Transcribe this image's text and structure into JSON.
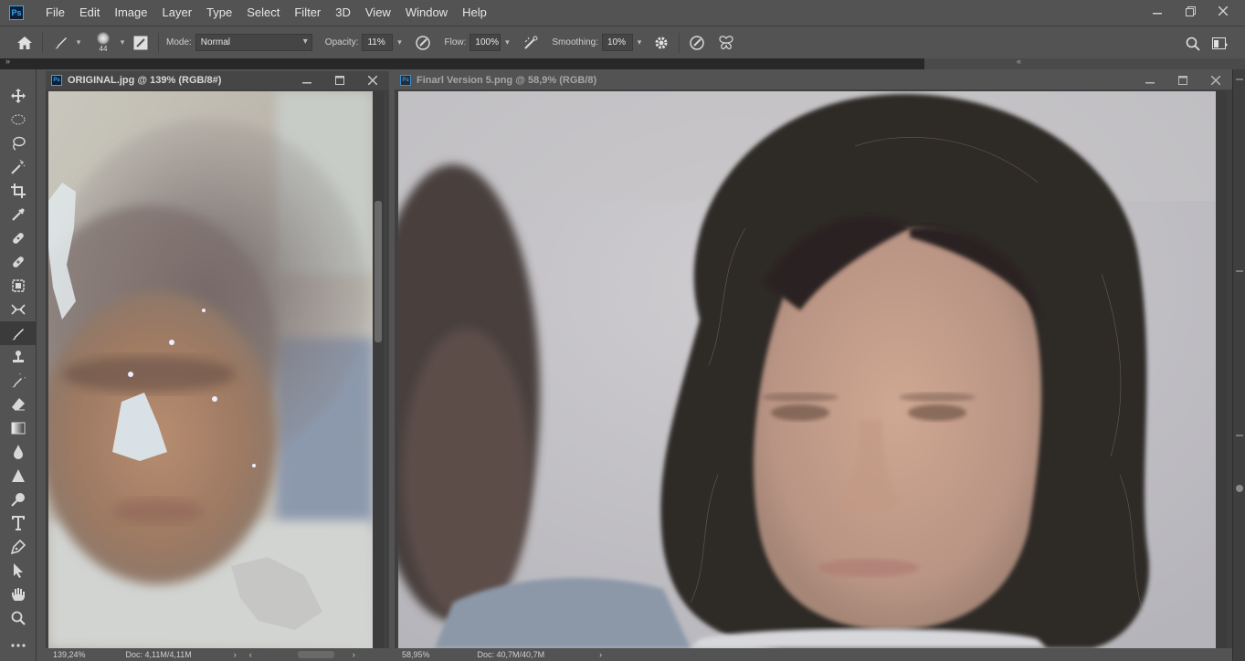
{
  "app": {
    "logo": "Ps",
    "menu": [
      "File",
      "Edit",
      "Image",
      "Layer",
      "Type",
      "Select",
      "Filter",
      "3D",
      "View",
      "Window",
      "Help"
    ],
    "window_controls": [
      "minimize-icon",
      "restore-icon",
      "close-icon"
    ]
  },
  "options": {
    "home_icon": "home-icon",
    "brush_preset_size": "44",
    "mode_label": "Mode:",
    "mode_value": "Normal",
    "opacity_label": "Opacity:",
    "opacity_value": "11%",
    "flow_label": "Flow:",
    "flow_value": "100%",
    "smoothing_label": "Smoothing:",
    "smoothing_value": "10%"
  },
  "tools": [
    "move-tool-icon",
    "marquee-tool-icon",
    "lasso-tool-icon",
    "magic-wand-tool-icon",
    "crop-tool-icon",
    "eyedropper-tool-icon",
    "spot-healing-tool-icon",
    "healing-brush-tool-icon",
    "patch-tool-icon",
    "content-aware-move-tool-icon",
    "brush-tool-icon",
    "clone-stamp-tool-icon",
    "history-brush-tool-icon",
    "eraser-tool-icon",
    "gradient-tool-icon",
    "blur-tool-icon",
    "sharpen-tool-icon",
    "dodge-tool-icon",
    "type-tool-icon",
    "pen-tool-icon",
    "path-selection-tool-icon",
    "hand-tool-icon",
    "zoom-tool-icon",
    "more-tools-icon"
  ],
  "documents": [
    {
      "title": "ORIGINAL.jpg @ 139% (RGB/8#)",
      "zoom": "139,24%",
      "doc_info": "Doc: 4,11M/4,11M"
    },
    {
      "title": "Finarl Version 5.png @ 58,9% (RGB/8)",
      "zoom": "58,95%",
      "doc_info": "Doc: 40,7M/40,7M"
    }
  ],
  "colors": {
    "accent": "#31a8ff",
    "chrome": "#535353",
    "dark": "#282828"
  }
}
